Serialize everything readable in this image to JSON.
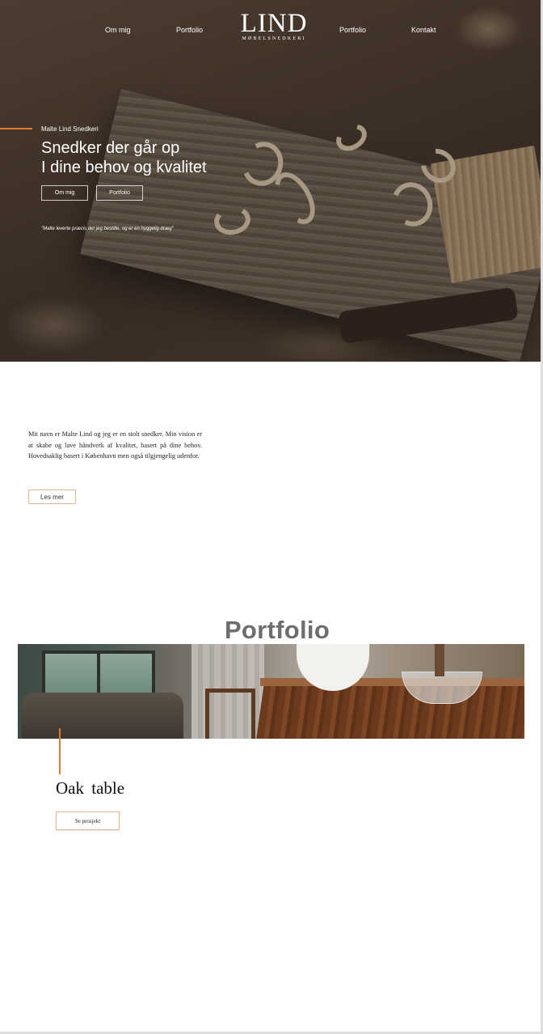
{
  "nav": {
    "links_left": [
      "Om mig",
      "Portfolio"
    ],
    "links_right": [
      "Portfolio",
      "Kontakt"
    ],
    "logo_main": "LIND",
    "logo_sub": "MØBELSNEDKERI"
  },
  "hero": {
    "eyebrow": "Malte Lind Snedkeri",
    "headline_line1": "Snedker der går op",
    "headline_line2": "I dine behov og kvalitet",
    "button_about": "Om mig",
    "button_portfolio": "Portfolio",
    "quote": "\"Malte leverte præcis det jeg bestilte, og er en hyggelig dræg\""
  },
  "about": {
    "text": "Mit navn er Malte Lind og jeg er en stolt snedker. Min vision er at skabe og lave håndverk af kvalitet, basert på dine behov. Hovedsaklig basert i København men også tilgjengelig udenfor.",
    "button": "Les mer"
  },
  "portfolio": {
    "title": "Portfolio",
    "item_title": "Oak table",
    "item_button": "Se prosjekt"
  },
  "colors": {
    "accent": "#e07a2e",
    "button_border": "#f1b38a",
    "portfolio_title": "#6d6d6d"
  }
}
